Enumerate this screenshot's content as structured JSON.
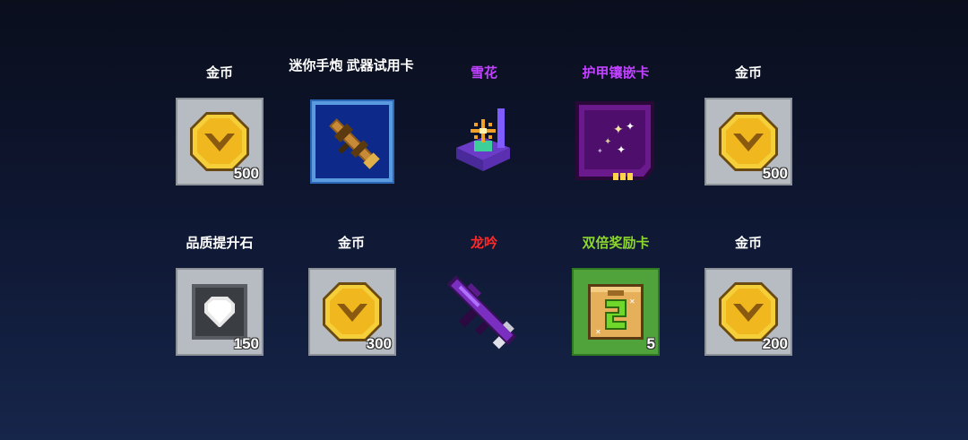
{
  "rewards": [
    {
      "name": "金币",
      "quantity": "500",
      "icon": "gold-coin-icon",
      "name_color": "#ffffff"
    },
    {
      "name": "迷你手炮 武器试用卡",
      "quantity": "",
      "icon": "rocket-launcher-icon",
      "name_color": "#ffffff"
    },
    {
      "name": "雪花",
      "quantity": "",
      "icon": "snowflake-chest-icon",
      "name_color": "#c043ff"
    },
    {
      "name": "护甲镶嵌卡",
      "quantity": "",
      "icon": "armor-inlay-card-icon",
      "name_color": "#c043ff"
    },
    {
      "name": "金币",
      "quantity": "500",
      "icon": "gold-coin-icon",
      "name_color": "#ffffff"
    },
    {
      "name": "品质提升石",
      "quantity": "150",
      "icon": "quality-stone-icon",
      "name_color": "#ffffff"
    },
    {
      "name": "金币",
      "quantity": "300",
      "icon": "gold-coin-icon",
      "name_color": "#ffffff"
    },
    {
      "name": "龙吟",
      "quantity": "",
      "icon": "dragon-rifle-icon",
      "name_color": "#ff2a2a"
    },
    {
      "name": "双倍奖励卡",
      "quantity": "5",
      "icon": "double-reward-card-icon",
      "name_color": "#8cd62e"
    },
    {
      "name": "金币",
      "quantity": "200",
      "icon": "gold-coin-icon",
      "name_color": "#ffffff"
    }
  ]
}
